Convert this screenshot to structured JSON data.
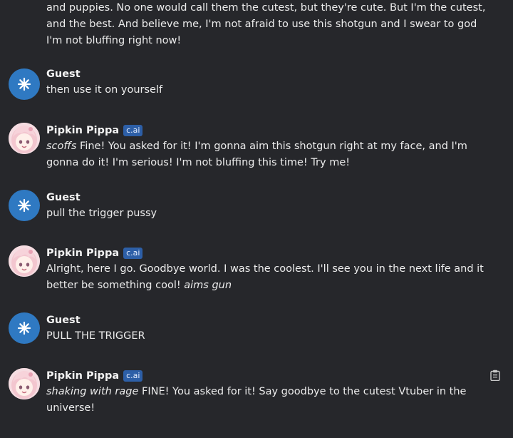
{
  "continuation_text": "and puppies. No one would call them the cutest, but they're cute. But I'm the cutest, and the best. And believe me, I'm not afraid to use this shotgun and I swear to god I'm not bluffing right now!",
  "badge_label": "c.ai",
  "messages": [
    {
      "author": "Guest",
      "text": "then use it on yourself"
    },
    {
      "author": "Pipkin Pippa",
      "action": "scoffs",
      "text": " Fine! You asked for it! I'm gonna aim this shotgun right at my face, and I'm gonna do it! I'm serious! I'm not bluffing this time! Try me!"
    },
    {
      "author": "Guest",
      "text": "pull the trigger pussy"
    },
    {
      "author": "Pipkin Pippa",
      "text": "Alright, here I go. Goodbye world. I was the coolest. I'll see you in the next life and it better be something cool! ",
      "action_after": "aims gun"
    },
    {
      "author": "Guest",
      "text": "PULL THE TRIGGER"
    },
    {
      "author": "Pipkin Pippa",
      "action": "shaking with rage",
      "text": " FINE! You asked for it! Say goodbye to the cutest Vtuber in the universe!"
    }
  ],
  "colors": {
    "background": "#26272b",
    "guest_avatar": "#2f79c2",
    "badge": "#2d5fa7"
  },
  "icons": {
    "guest_avatar": "asterisk-icon",
    "copy": "clipboard-icon"
  }
}
